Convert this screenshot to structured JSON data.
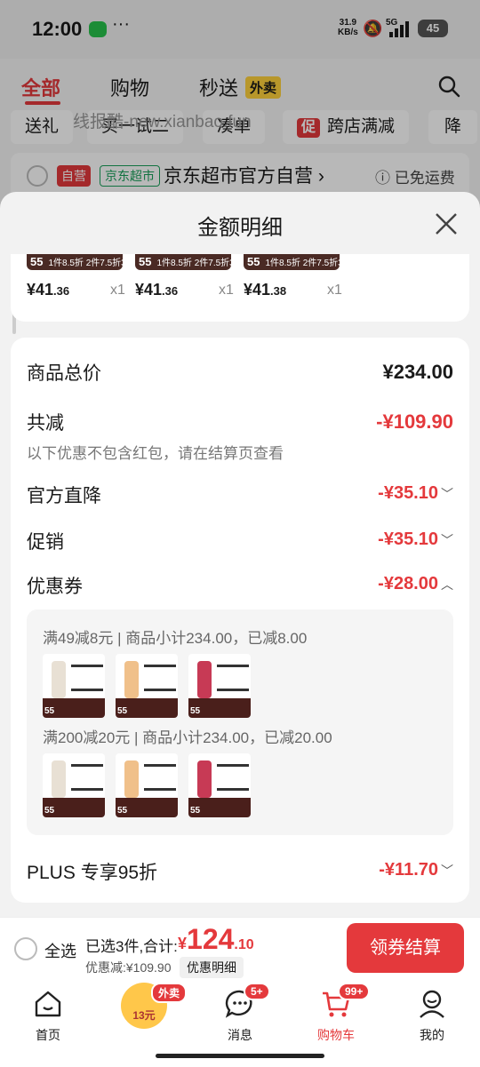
{
  "status_bar": {
    "time": "12:00",
    "net_speed": "31.9",
    "net_unit": "KB/s",
    "signal": "5G",
    "battery": "45"
  },
  "background": {
    "tabs": [
      "全部",
      "购物",
      "秒送"
    ],
    "waimai_badge": "外卖",
    "chips": [
      "送礼",
      "买一试二",
      "凑单",
      "跨店满减",
      "降"
    ],
    "chip_cu": "促",
    "watermark": "线报酷-new.xianbao.fun",
    "shop": {
      "tag_self": "自营",
      "tag_super": "京东超市",
      "name": "京东超市官方自营",
      "chevron": "›",
      "free_ship": "ⓘ 已免运费"
    }
  },
  "sheet": {
    "title": "金额明细",
    "products": [
      {
        "strip_big": "55",
        "strip_text": "1件8.5折 2件7.5折3件7折",
        "price_int": "¥41",
        "price_dec": ".36",
        "qty": "x1"
      },
      {
        "strip_big": "55",
        "strip_text": "1件8.5折 2件7.5折3件7折",
        "price_int": "¥41",
        "price_dec": ".36",
        "qty": "x1"
      },
      {
        "strip_big": "55",
        "strip_text": "1件8.5折 2件7.5折3件7折",
        "price_int": "¥41",
        "price_dec": ".38",
        "qty": "x1"
      }
    ],
    "total_label": "商品总价",
    "total_value": "¥234.00",
    "reduce_label": "共减",
    "reduce_value": "-¥109.90",
    "note": "以下优惠不包含红包，请在结算页查看",
    "rows": [
      {
        "label": "官方直降",
        "value": "-¥35.10",
        "chev": "﹀"
      },
      {
        "label": "促销",
        "value": "-¥35.10",
        "chev": "﹀"
      },
      {
        "label": "优惠券",
        "value": "-¥28.00",
        "chev": "︿"
      }
    ],
    "coupons": [
      {
        "text": "满49减8元 | 商品小计234.00，已减8.00"
      },
      {
        "text": "满200减20元 | 商品小计234.00，已减20.00"
      }
    ],
    "thumb_number": "55",
    "plus_label": "PLUS 专享95折",
    "plus_value": "-¥11.70",
    "plus_chev": "﹀"
  },
  "checkout": {
    "select_all": "全选",
    "selected": "已选3件,合计:",
    "currency": "¥",
    "amount_int": "124",
    "amount_dec": ".10",
    "discount": "优惠减:¥109.90",
    "detail_btn": "优惠明细",
    "pay_btn": "领券结算"
  },
  "nav": {
    "home": "首页",
    "center_badge": "外卖",
    "center_amount": "13元",
    "messages": "消息",
    "messages_badge": "5+",
    "cart": "购物车",
    "cart_badge": "99+",
    "me": "我的"
  },
  "colors": {
    "accent": "#e4393c",
    "badge_yellow": "#ffd23c"
  }
}
